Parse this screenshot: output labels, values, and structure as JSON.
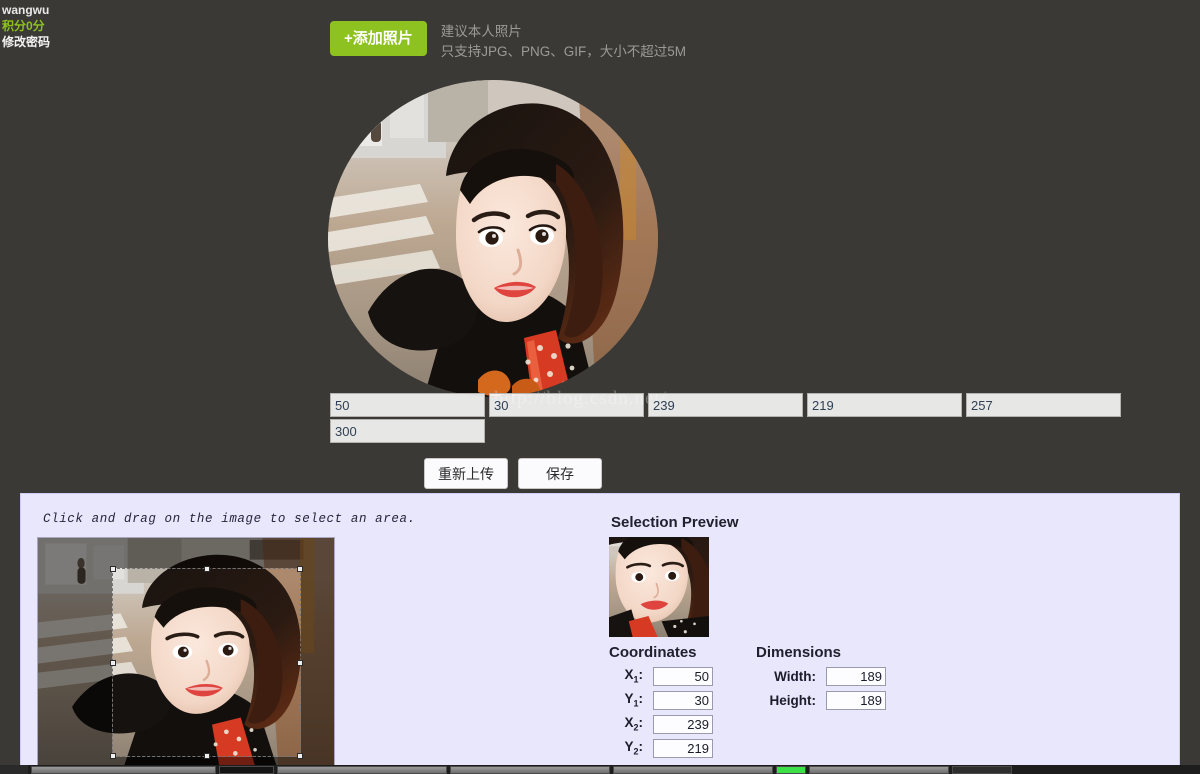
{
  "sidebar": {
    "username": "wangwu",
    "points": "积分0分",
    "change_password": "修改密码"
  },
  "upload": {
    "add_photo_label": "+添加照片",
    "hint_line1": "建议本人照片",
    "hint_line2": "只支持JPG、PNG、GIF，大小不超过5M"
  },
  "watermark": "http://blog.csdn.net/",
  "crop_form": {
    "x1": "50",
    "y1": "30",
    "x2": "239",
    "y2": "219",
    "width": "257",
    "height": "300"
  },
  "actions": {
    "reupload_label": "重新上传",
    "save_label": "保存"
  },
  "jcrop": {
    "hint": "Click and drag on the image to select an area.",
    "preview_title": "Selection Preview",
    "coordinates_title": "Coordinates",
    "dimensions_title": "Dimensions",
    "labels": {
      "x1": "X",
      "y1": "Y",
      "x2": "X",
      "y2": "Y",
      "x1_sub": "1",
      "y1_sub": "1",
      "x2_sub": "2",
      "y2_sub": "2",
      "width": "Width:",
      "height": "Height:"
    },
    "values": {
      "x1": "50",
      "y1": "30",
      "x2": "239",
      "y2": "219",
      "width": "189",
      "height": "189"
    }
  },
  "colors": {
    "page_background": "#3b3935",
    "accent_green": "#8dc220",
    "panel_background": "#e9e7fc",
    "panel_border": "#cfccf3",
    "input_text": "#2f3f55"
  }
}
